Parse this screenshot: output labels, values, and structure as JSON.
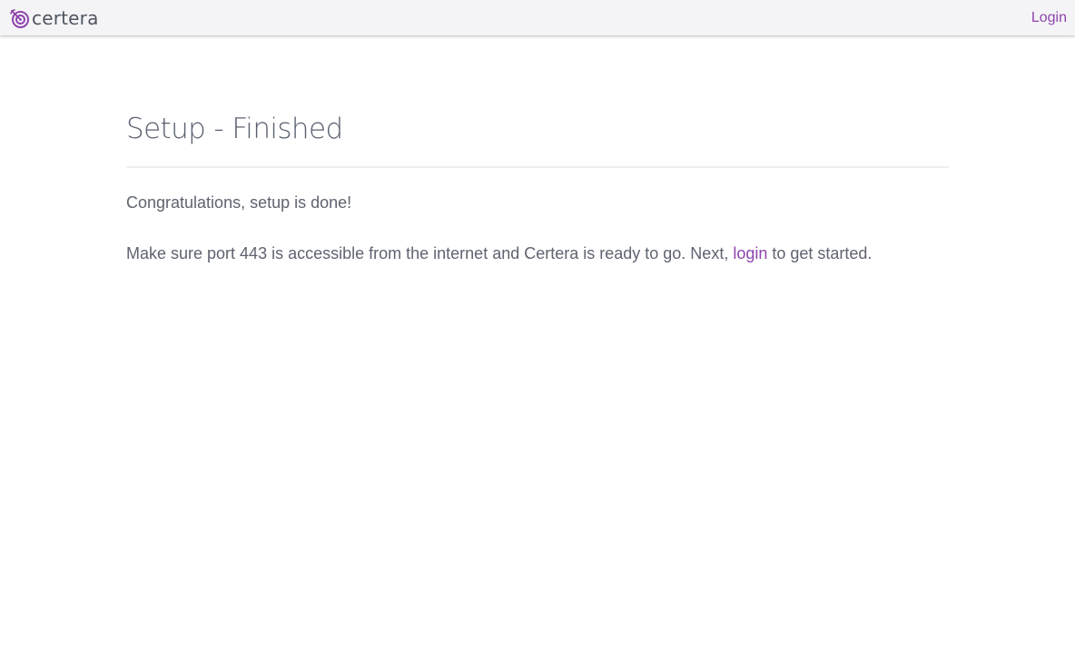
{
  "navbar": {
    "brand_name": "certera",
    "brand_icon": "target-icon",
    "login_label": "Login",
    "accent_color": "#8e44ad"
  },
  "main": {
    "title": "Setup - Finished",
    "congrats_text": "Congratulations, setup is done!",
    "instructions_before": "Make sure port 443 is accessible from the internet and Certera is ready to go. Next, ",
    "instructions_link": "login",
    "instructions_after": " to get started."
  }
}
